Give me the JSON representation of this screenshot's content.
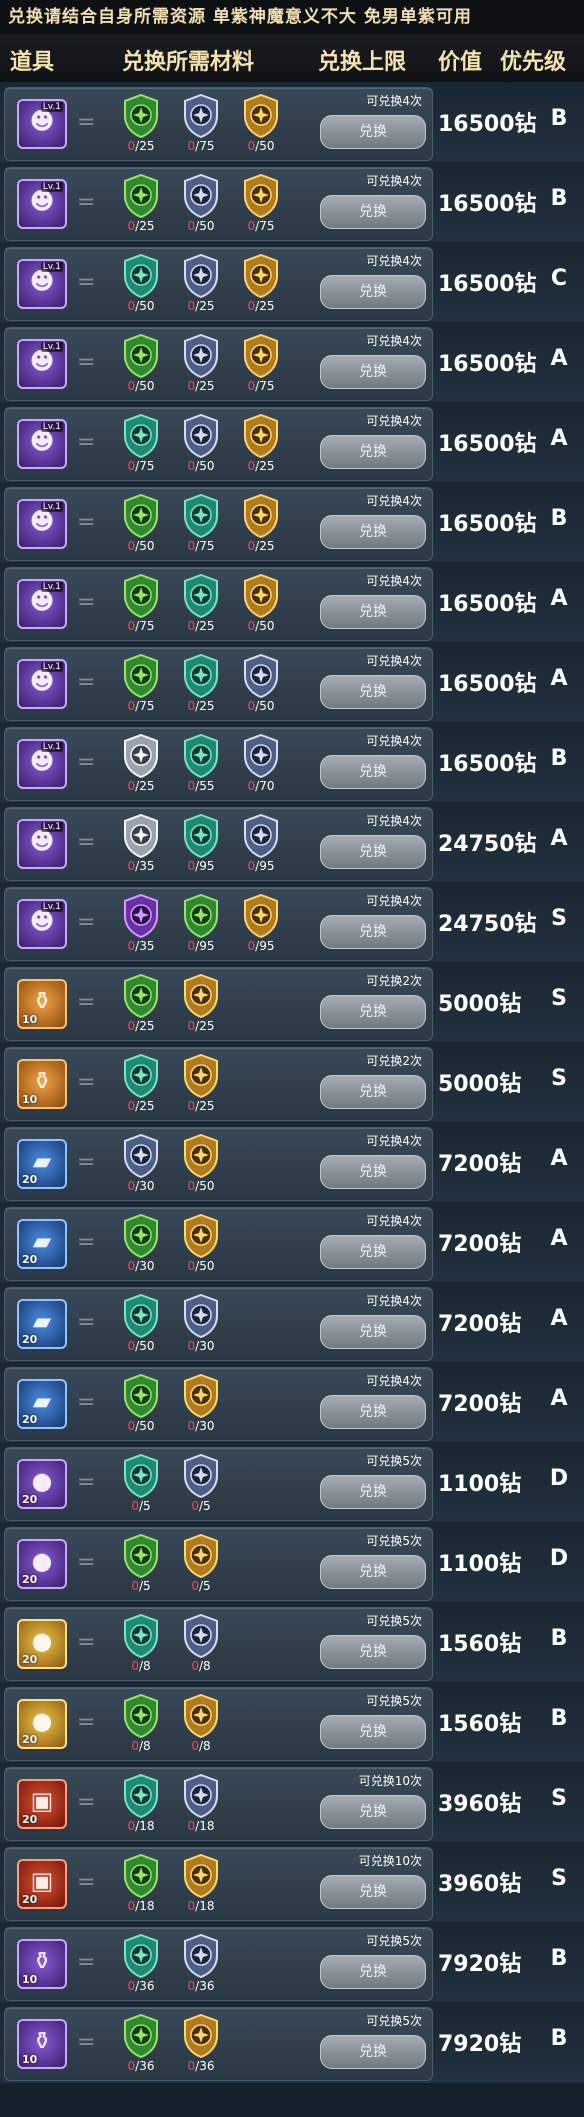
{
  "banner": "兑换请结合自身所需资源 单紫神魔意义不大 免男单紫可用",
  "header": {
    "col_item": "道具",
    "col_materials": "兑换所需材料",
    "col_limit": "兑换上限",
    "col_value": "价值",
    "col_priority": "优先级"
  },
  "equals": "=",
  "exchange_label": "兑换",
  "rows": [
    {
      "item": {
        "kind": "hero",
        "color": "purple",
        "lvl": "Lv.1",
        "num": ""
      },
      "materials": [
        {
          "icon": "green-medal",
          "have": "0",
          "need": "/25"
        },
        {
          "icon": "silver-medal",
          "have": "0",
          "need": "/75"
        },
        {
          "icon": "gold-medal",
          "have": "0",
          "need": "/50"
        }
      ],
      "limit": "可兑换4次",
      "value": "16500钻",
      "priority": "B"
    },
    {
      "item": {
        "kind": "hero",
        "color": "purple",
        "lvl": "Lv.1",
        "num": ""
      },
      "materials": [
        {
          "icon": "green-medal",
          "have": "0",
          "need": "/25"
        },
        {
          "icon": "silver-medal",
          "have": "0",
          "need": "/50"
        },
        {
          "icon": "gold-medal",
          "have": "0",
          "need": "/75"
        }
      ],
      "limit": "可兑换4次",
      "value": "16500钻",
      "priority": "B"
    },
    {
      "item": {
        "kind": "hero",
        "color": "purple",
        "lvl": "Lv.1",
        "num": ""
      },
      "materials": [
        {
          "icon": "teal-medal",
          "have": "0",
          "need": "/50"
        },
        {
          "icon": "silver-medal",
          "have": "0",
          "need": "/25"
        },
        {
          "icon": "gold-medal",
          "have": "0",
          "need": "/25"
        }
      ],
      "limit": "可兑换4次",
      "value": "16500钻",
      "priority": "C"
    },
    {
      "item": {
        "kind": "hero",
        "color": "purple",
        "lvl": "Lv.1",
        "num": ""
      },
      "materials": [
        {
          "icon": "green-medal",
          "have": "0",
          "need": "/50"
        },
        {
          "icon": "silver-medal",
          "have": "0",
          "need": "/25"
        },
        {
          "icon": "gold-medal",
          "have": "0",
          "need": "/75"
        }
      ],
      "limit": "可兑换4次",
      "value": "16500钻",
      "priority": "A"
    },
    {
      "item": {
        "kind": "hero",
        "color": "purple",
        "lvl": "Lv.1",
        "num": ""
      },
      "materials": [
        {
          "icon": "teal-medal",
          "have": "0",
          "need": "/75"
        },
        {
          "icon": "silver-medal",
          "have": "0",
          "need": "/50"
        },
        {
          "icon": "gold-medal",
          "have": "0",
          "need": "/25"
        }
      ],
      "limit": "可兑换4次",
      "value": "16500钻",
      "priority": "A"
    },
    {
      "item": {
        "kind": "hero",
        "color": "purple",
        "lvl": "Lv.1",
        "num": ""
      },
      "materials": [
        {
          "icon": "green-medal",
          "have": "0",
          "need": "/50"
        },
        {
          "icon": "teal-medal",
          "have": "0",
          "need": "/75"
        },
        {
          "icon": "gold-medal",
          "have": "0",
          "need": "/25"
        }
      ],
      "limit": "可兑换4次",
      "value": "16500钻",
      "priority": "B"
    },
    {
      "item": {
        "kind": "hero",
        "color": "purple",
        "lvl": "Lv.1",
        "num": ""
      },
      "materials": [
        {
          "icon": "green-medal",
          "have": "0",
          "need": "/75"
        },
        {
          "icon": "teal-medal",
          "have": "0",
          "need": "/25"
        },
        {
          "icon": "gold-medal",
          "have": "0",
          "need": "/50"
        }
      ],
      "limit": "可兑换4次",
      "value": "16500钻",
      "priority": "A"
    },
    {
      "item": {
        "kind": "hero",
        "color": "purple",
        "lvl": "Lv.1",
        "num": ""
      },
      "materials": [
        {
          "icon": "green-medal",
          "have": "0",
          "need": "/75"
        },
        {
          "icon": "teal-medal",
          "have": "0",
          "need": "/25"
        },
        {
          "icon": "silver-medal",
          "have": "0",
          "need": "/50"
        }
      ],
      "limit": "可兑换4次",
      "value": "16500钻",
      "priority": "A"
    },
    {
      "item": {
        "kind": "hero",
        "color": "purple",
        "lvl": "Lv.1",
        "num": ""
      },
      "materials": [
        {
          "icon": "white-medal",
          "have": "0",
          "need": "/25"
        },
        {
          "icon": "teal-medal",
          "have": "0",
          "need": "/55"
        },
        {
          "icon": "silver-medal",
          "have": "0",
          "need": "/70"
        }
      ],
      "limit": "可兑换4次",
      "value": "16500钻",
      "priority": "B"
    },
    {
      "item": {
        "kind": "hero",
        "color": "purple",
        "lvl": "Lv.1",
        "num": ""
      },
      "materials": [
        {
          "icon": "white-medal",
          "have": "0",
          "need": "/35"
        },
        {
          "icon": "teal-medal",
          "have": "0",
          "need": "/95"
        },
        {
          "icon": "silver-medal",
          "have": "0",
          "need": "/95"
        }
      ],
      "limit": "可兑换4次",
      "value": "24750钻",
      "priority": "A"
    },
    {
      "item": {
        "kind": "hero",
        "color": "purple",
        "lvl": "Lv.1",
        "num": ""
      },
      "materials": [
        {
          "icon": "purple-medal",
          "have": "0",
          "need": "/35"
        },
        {
          "icon": "green-medal",
          "have": "0",
          "need": "/95"
        },
        {
          "icon": "gold-medal",
          "have": "0",
          "need": "/95"
        }
      ],
      "limit": "可兑换4次",
      "value": "24750钻",
      "priority": "S"
    },
    {
      "item": {
        "kind": "scroll",
        "color": "orange",
        "lvl": "",
        "num": "10"
      },
      "materials": [
        {
          "icon": "green-medal",
          "have": "0",
          "need": "/25"
        },
        {
          "icon": "gold-medal",
          "have": "0",
          "need": "/25"
        }
      ],
      "limit": "可兑换2次",
      "value": "5000钻",
      "priority": "S"
    },
    {
      "item": {
        "kind": "scroll",
        "color": "orange",
        "lvl": "",
        "num": "10"
      },
      "materials": [
        {
          "icon": "teal-medal",
          "have": "0",
          "need": "/25"
        },
        {
          "icon": "gold-medal",
          "have": "0",
          "need": "/25"
        }
      ],
      "limit": "可兑换2次",
      "value": "5000钻",
      "priority": "S"
    },
    {
      "item": {
        "kind": "card",
        "color": "blue",
        "lvl": "",
        "num": "20"
      },
      "materials": [
        {
          "icon": "silver-medal",
          "have": "0",
          "need": "/30"
        },
        {
          "icon": "gold-medal",
          "have": "0",
          "need": "/50"
        }
      ],
      "limit": "可兑换4次",
      "value": "7200钻",
      "priority": "A"
    },
    {
      "item": {
        "kind": "card",
        "color": "blue",
        "lvl": "",
        "num": "20"
      },
      "materials": [
        {
          "icon": "green-medal",
          "have": "0",
          "need": "/30"
        },
        {
          "icon": "gold-medal",
          "have": "0",
          "need": "/50"
        }
      ],
      "limit": "可兑换4次",
      "value": "7200钻",
      "priority": "A"
    },
    {
      "item": {
        "kind": "card",
        "color": "blue",
        "lvl": "",
        "num": "20"
      },
      "materials": [
        {
          "icon": "teal-medal",
          "have": "0",
          "need": "/50"
        },
        {
          "icon": "silver-medal",
          "have": "0",
          "need": "/30"
        }
      ],
      "limit": "可兑换4次",
      "value": "7200钻",
      "priority": "A"
    },
    {
      "item": {
        "kind": "card",
        "color": "blue",
        "lvl": "",
        "num": "20"
      },
      "materials": [
        {
          "icon": "green-medal",
          "have": "0",
          "need": "/50"
        },
        {
          "icon": "gold-medal",
          "have": "0",
          "need": "/30"
        }
      ],
      "limit": "可兑换4次",
      "value": "7200钻",
      "priority": "A"
    },
    {
      "item": {
        "kind": "coin",
        "color": "purple",
        "lvl": "",
        "num": "20"
      },
      "materials": [
        {
          "icon": "teal-medal",
          "have": "0",
          "need": "/5"
        },
        {
          "icon": "silver-medal",
          "have": "0",
          "need": "/5"
        }
      ],
      "limit": "可兑换5次",
      "value": "1100钻",
      "priority": "D"
    },
    {
      "item": {
        "kind": "coin",
        "color": "purple",
        "lvl": "",
        "num": "20"
      },
      "materials": [
        {
          "icon": "green-medal",
          "have": "0",
          "need": "/5"
        },
        {
          "icon": "gold-medal",
          "have": "0",
          "need": "/5"
        }
      ],
      "limit": "可兑换5次",
      "value": "1100钻",
      "priority": "D"
    },
    {
      "item": {
        "kind": "coin",
        "color": "gold",
        "lvl": "",
        "num": "20"
      },
      "materials": [
        {
          "icon": "teal-medal",
          "have": "0",
          "need": "/8"
        },
        {
          "icon": "silver-medal",
          "have": "0",
          "need": "/8"
        }
      ],
      "limit": "可兑换5次",
      "value": "1560钻",
      "priority": "B"
    },
    {
      "item": {
        "kind": "coin",
        "color": "gold",
        "lvl": "",
        "num": "20"
      },
      "materials": [
        {
          "icon": "green-medal",
          "have": "0",
          "need": "/8"
        },
        {
          "icon": "gold-medal",
          "have": "0",
          "need": "/8"
        }
      ],
      "limit": "可兑换5次",
      "value": "1560钻",
      "priority": "B"
    },
    {
      "item": {
        "kind": "chest",
        "color": "red",
        "lvl": "",
        "num": "20"
      },
      "materials": [
        {
          "icon": "teal-medal",
          "have": "0",
          "need": "/18"
        },
        {
          "icon": "silver-medal",
          "have": "0",
          "need": "/18"
        }
      ],
      "limit": "可兑换10次",
      "value": "3960钻",
      "priority": "S"
    },
    {
      "item": {
        "kind": "chest",
        "color": "red",
        "lvl": "",
        "num": "20"
      },
      "materials": [
        {
          "icon": "green-medal",
          "have": "0",
          "need": "/18"
        },
        {
          "icon": "gold-medal",
          "have": "0",
          "need": "/18"
        }
      ],
      "limit": "可兑换10次",
      "value": "3960钻",
      "priority": "S"
    },
    {
      "item": {
        "kind": "scroll",
        "color": "purple",
        "lvl": "",
        "num": "10"
      },
      "materials": [
        {
          "icon": "teal-medal",
          "have": "0",
          "need": "/36"
        },
        {
          "icon": "silver-medal",
          "have": "0",
          "need": "/36"
        }
      ],
      "limit": "可兑换5次",
      "value": "7920钻",
      "priority": "B"
    },
    {
      "item": {
        "kind": "scroll",
        "color": "purple",
        "lvl": "",
        "num": "10"
      },
      "materials": [
        {
          "icon": "green-medal",
          "have": "0",
          "need": "/36"
        },
        {
          "icon": "gold-medal",
          "have": "0",
          "need": "/36"
        }
      ],
      "limit": "可兑换5次",
      "value": "7920钻",
      "priority": "B"
    }
  ]
}
